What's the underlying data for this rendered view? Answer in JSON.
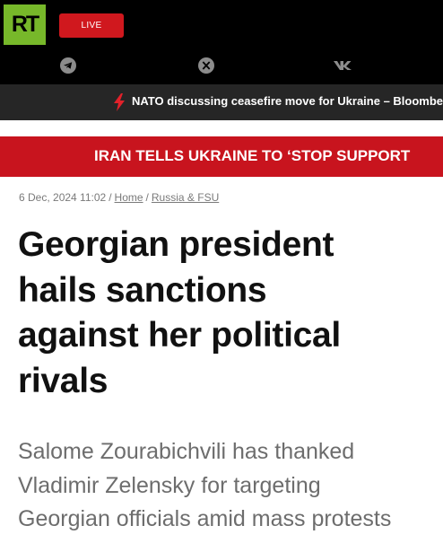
{
  "header": {
    "logo_text": "RT",
    "live_label": "LIVE",
    "social_icons": [
      "telegram-icon",
      "x-icon",
      "vk-icon"
    ]
  },
  "breaking": {
    "text": "NATO discussing ceasefire move for Ukraine – Bloomberg"
  },
  "top_headline": {
    "text": "IRAN TELLS UKRAINE TO ‘STOP SUPPORT"
  },
  "article": {
    "datetime": "6 Dec, 2024 11:02",
    "breadcrumbs": [
      "Home",
      "Russia & FSU"
    ],
    "title_lines": [
      "Georgian president",
      "hails sanctions",
      "against her political",
      "rivals"
    ],
    "summary_lines": [
      "Salome Zourabichvili has thanked",
      "Vladimir Zelensky for targeting",
      "Georgian officials amid mass protests"
    ]
  },
  "colors": {
    "brand_green": "#77b82a",
    "live_red": "#d0181e",
    "banner_red": "#c8141e",
    "bolt_red": "#e2212a",
    "header_black": "#000000",
    "breaking_bg": "#262626"
  }
}
